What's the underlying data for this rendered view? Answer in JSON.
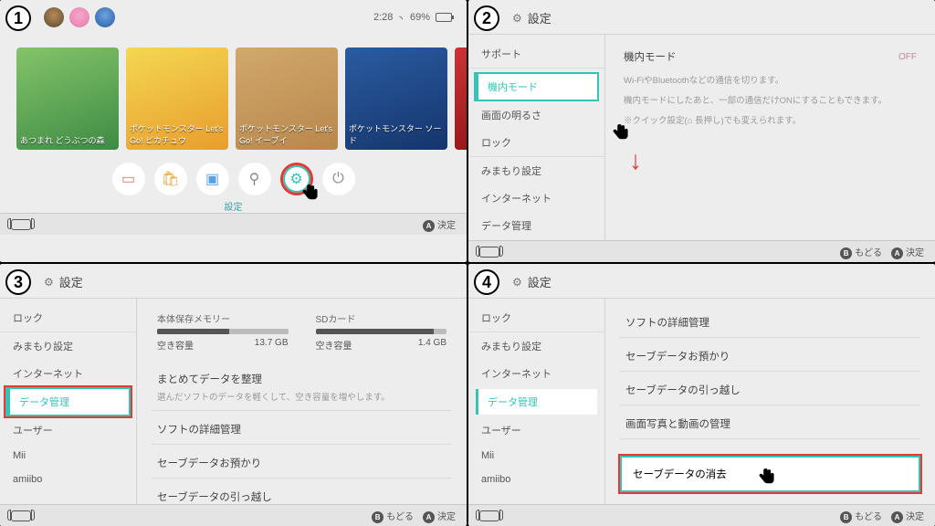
{
  "home": {
    "time": "2:28",
    "battery_pct": "69%",
    "games": [
      {
        "label": "あつまれ どうぶつの森"
      },
      {
        "label": "ポケットモンスター Let's Go! ピカチュウ"
      },
      {
        "label": "ポケットモンスター Let's Go! イーブイ"
      },
      {
        "label": "ポケットモンスター ソード"
      },
      {
        "label": ""
      }
    ],
    "settings_label": "設定",
    "button_a": "決定"
  },
  "panel2": {
    "header": "設定",
    "sidebar": [
      "サポート",
      "機内モード",
      "画面の明るさ",
      "ロック",
      "みまもり設定",
      "インターネット",
      "データ管理"
    ],
    "selected_idx": 1,
    "main": {
      "title": "機内モード",
      "toggle": "OFF",
      "desc1": "Wi-FiやBluetoothなどの通信を切ります。",
      "desc2": "機内モードにしたあと、一部の通信だけONにすることもできます。",
      "desc3": "※クイック設定(⌂ 長押し)でも変えられます。"
    },
    "button_b": "もどる",
    "button_a": "決定"
  },
  "panel3": {
    "header": "設定",
    "sidebar": [
      "ロック",
      "みまもり設定",
      "インターネット",
      "データ管理",
      "ユーザー",
      "Mii",
      "amiibo"
    ],
    "selected_idx": 3,
    "storage": {
      "internal": {
        "label": "本体保存メモリー",
        "freelabel": "空き容量",
        "free": "13.7 GB",
        "used_pct": 55
      },
      "sd": {
        "label": "SDカード",
        "freelabel": "空き容量",
        "free": "1.4 GB",
        "used_pct": 90
      }
    },
    "rows": {
      "organize_title": "まとめてデータを整理",
      "organize_desc": "選んだソフトのデータを軽くして、空き容量を増やします。",
      "software_mgmt": "ソフトの詳細管理",
      "save_keep": "セーブデータお預かり",
      "save_move": "セーブデータの引っ越し"
    },
    "button_b": "もどる",
    "button_a": "決定"
  },
  "panel4": {
    "header": "設定",
    "sidebar": [
      "ロック",
      "みまもり設定",
      "インターネット",
      "データ管理",
      "ユーザー",
      "Mii",
      "amiibo"
    ],
    "selected_idx": 3,
    "rows": {
      "software_mgmt": "ソフトの詳細管理",
      "save_keep": "セーブデータお預かり",
      "save_move": "セーブデータの引っ越し",
      "media_mgmt": "画面写真と動画の管理",
      "delete_save": "セーブデータの消去"
    },
    "button_b": "もどる",
    "button_a": "決定"
  }
}
